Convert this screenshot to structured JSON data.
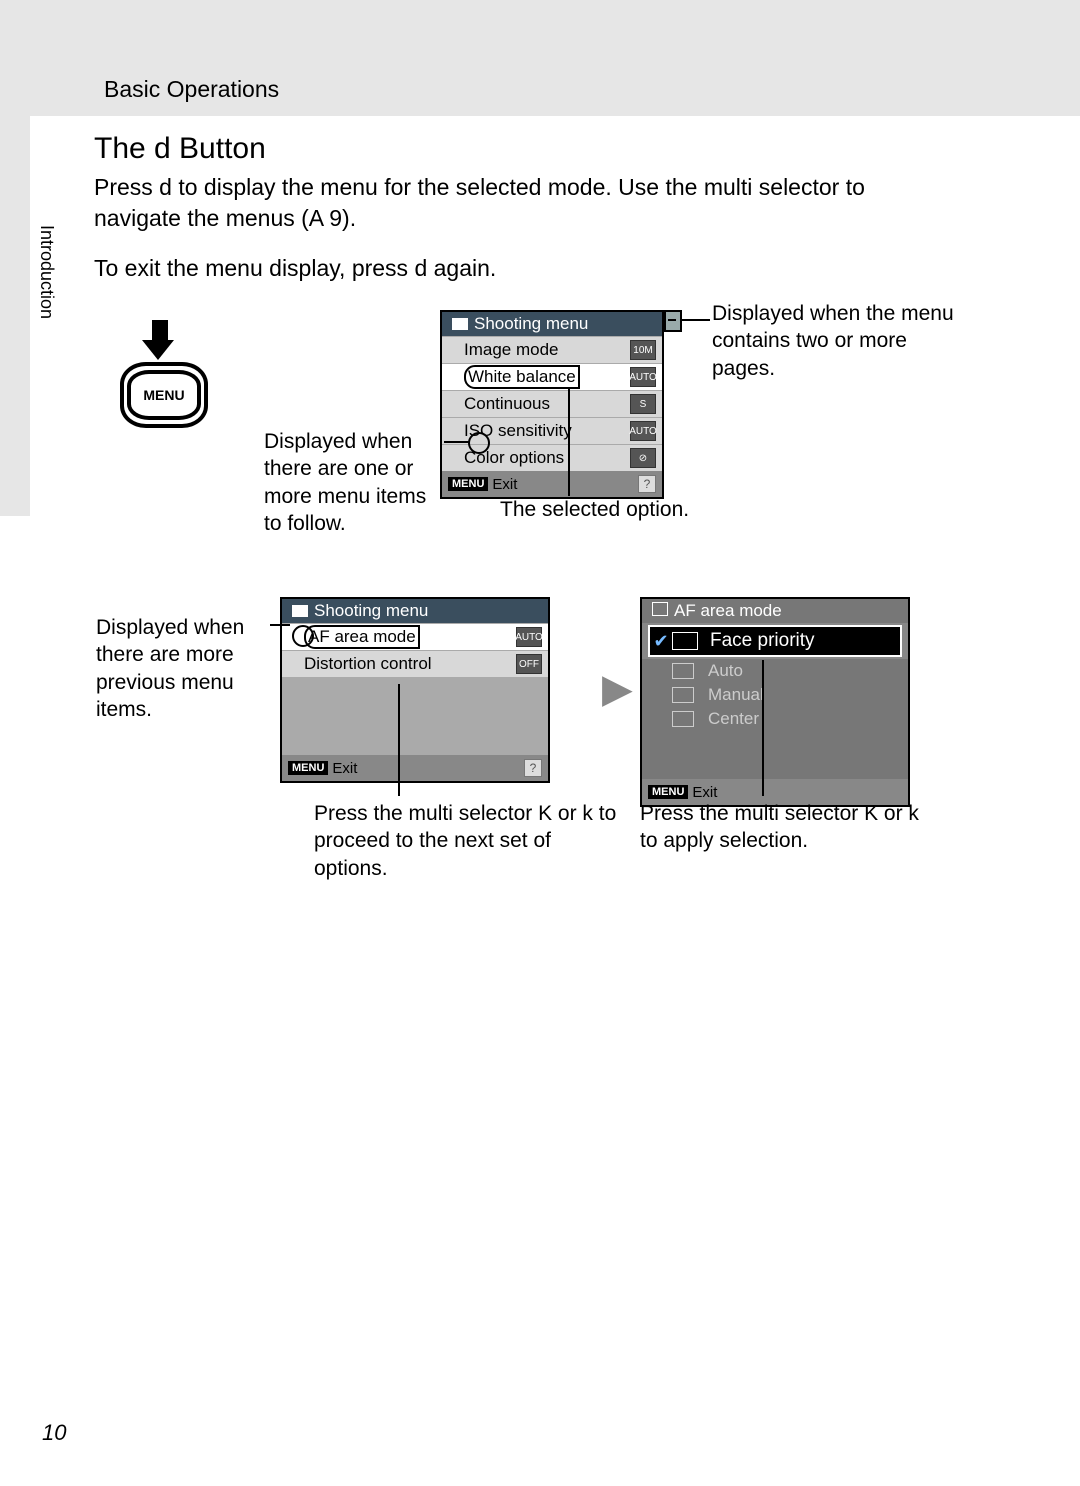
{
  "header": {
    "section": "Basic Operations"
  },
  "side": {
    "label": "Introduction"
  },
  "title": "The d Button",
  "para1": "Press d to display the menu for the selected mode. Use the multi selector to navigate the menus (A 9).",
  "para2": "To exit the menu display, press d again.",
  "menu_btn": {
    "label": "MENU"
  },
  "lcd1": {
    "title": "Shooting menu",
    "items": [
      {
        "label": "Image mode",
        "badge": "10M"
      },
      {
        "label": "White balance",
        "badge": "AUTO",
        "selected": true
      },
      {
        "label": "Continuous",
        "badge": "S"
      },
      {
        "label": "ISO sensitivity",
        "badge": "AUTO"
      },
      {
        "label": "Color options",
        "badge": "⊘"
      }
    ],
    "exit_tag": "MENU",
    "exit": "Exit",
    "help": "?"
  },
  "ann": {
    "pages": "Displayed when the menu contains two or more pages.",
    "follow": "Displayed when there are one or more menu items to follow.",
    "selected": "The selected option.",
    "prev": "Displayed when there are more previous menu items.",
    "proceed": "Press the multi selector K or k to proceed to the next set of options.",
    "apply": "Press the multi selector K or k to apply selection."
  },
  "lcd2": {
    "title": "Shooting menu",
    "items": [
      {
        "label": "AF area mode",
        "badge": "AUTO",
        "selected": true
      },
      {
        "label": "Distortion control",
        "badge": "OFF"
      }
    ],
    "exit_tag": "MENU",
    "exit": "Exit",
    "help": "?"
  },
  "lcd3": {
    "title": "AF area mode",
    "selected": "Face priority",
    "options": [
      "Auto",
      "Manual",
      "Center"
    ],
    "exit_tag": "MENU",
    "exit": "Exit"
  },
  "page_number": "10"
}
